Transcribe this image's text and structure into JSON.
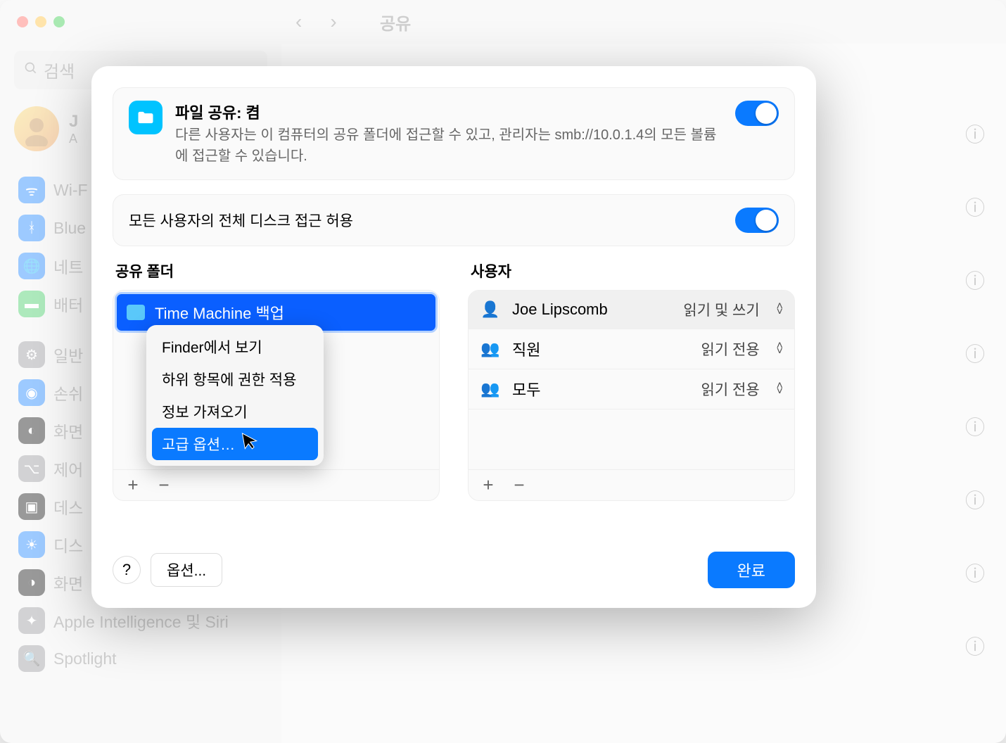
{
  "window": {
    "title": "공유"
  },
  "sidebar": {
    "search_placeholder": "검색",
    "user_initial": "J",
    "user_sub": "A",
    "items": [
      {
        "label": "Wi-F"
      },
      {
        "label": "Blue"
      },
      {
        "label": "네트"
      },
      {
        "label": "배터"
      },
      {
        "label": "일반"
      },
      {
        "label": "손쉬"
      },
      {
        "label": "화면"
      },
      {
        "label": "제어"
      },
      {
        "label": "데스"
      },
      {
        "label": "디스"
      },
      {
        "label": "화면"
      },
      {
        "label": "Apple Intelligence 및 Siri"
      },
      {
        "label": "Spotlight"
      }
    ]
  },
  "file_sharing": {
    "title": "파일 공유: 켬",
    "description": "다른 사용자는 이 컴퓨터의 공유 폴더에 접근할 수 있고, 관리자는 smb://10.0.1.4의 모든 볼륨에 접근할 수 있습니다."
  },
  "full_disk": {
    "label": "모든 사용자의 전체 디스크 접근 허용"
  },
  "shared_folders": {
    "label": "공유 폴더",
    "items": [
      "Time Machine 백업"
    ]
  },
  "users": {
    "label": "사용자",
    "rows": [
      {
        "name": "Joe Lipscomb",
        "permission": "읽기 및 쓰기"
      },
      {
        "name": "직원",
        "permission": "읽기 전용"
      },
      {
        "name": "모두",
        "permission": "읽기 전용"
      }
    ]
  },
  "context_menu": {
    "items": [
      "Finder에서 보기",
      "하위 항목에 권한 적용",
      "정보 가져오기",
      "고급 옵션…"
    ]
  },
  "footer": {
    "help": "?",
    "options": "옵션...",
    "done": "완료"
  }
}
